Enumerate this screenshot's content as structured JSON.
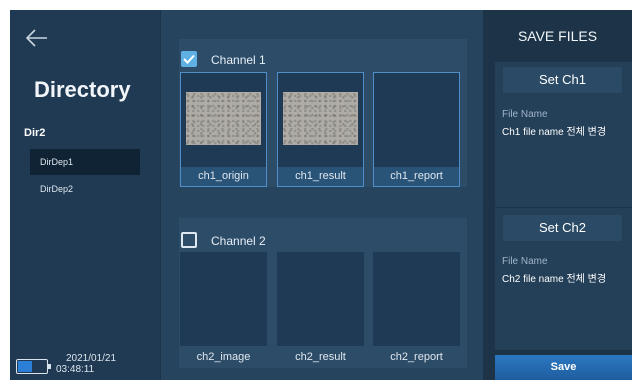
{
  "sidebar": {
    "title": "Directory",
    "current_dir": "Dir2",
    "items": [
      {
        "label": "DirDep1",
        "selected": true
      },
      {
        "label": "DirDep2",
        "selected": false
      }
    ],
    "status": {
      "date": "2021/01/21",
      "time": "03:48:11",
      "battery_level": 0.45
    }
  },
  "channels": [
    {
      "label": "Channel 1",
      "checked": true,
      "files": [
        {
          "label": "ch1_origin",
          "has_image": true
        },
        {
          "label": "ch1_result",
          "has_image": true
        },
        {
          "label": "ch1_report",
          "has_image": false
        }
      ]
    },
    {
      "label": "Channel 2",
      "checked": false,
      "files": [
        {
          "label": "ch2_image"
        },
        {
          "label": "ch2_result"
        },
        {
          "label": "ch2_report"
        }
      ]
    }
  ],
  "save_panel": {
    "title": "SAVE FILES",
    "ch1": {
      "button": "Set Ch1",
      "file_name_label": "File Name",
      "file_name_value": "Ch1 file name 전체 변경"
    },
    "ch2": {
      "button": "Set Ch2",
      "file_name_label": "File Name",
      "file_name_value": "Ch2 file name 전체 변경"
    },
    "save_button": "Save"
  },
  "colors": {
    "accent": "#5fb0e3",
    "save_button": "#2a78c2",
    "battery_fill": "#2b7fd6"
  }
}
